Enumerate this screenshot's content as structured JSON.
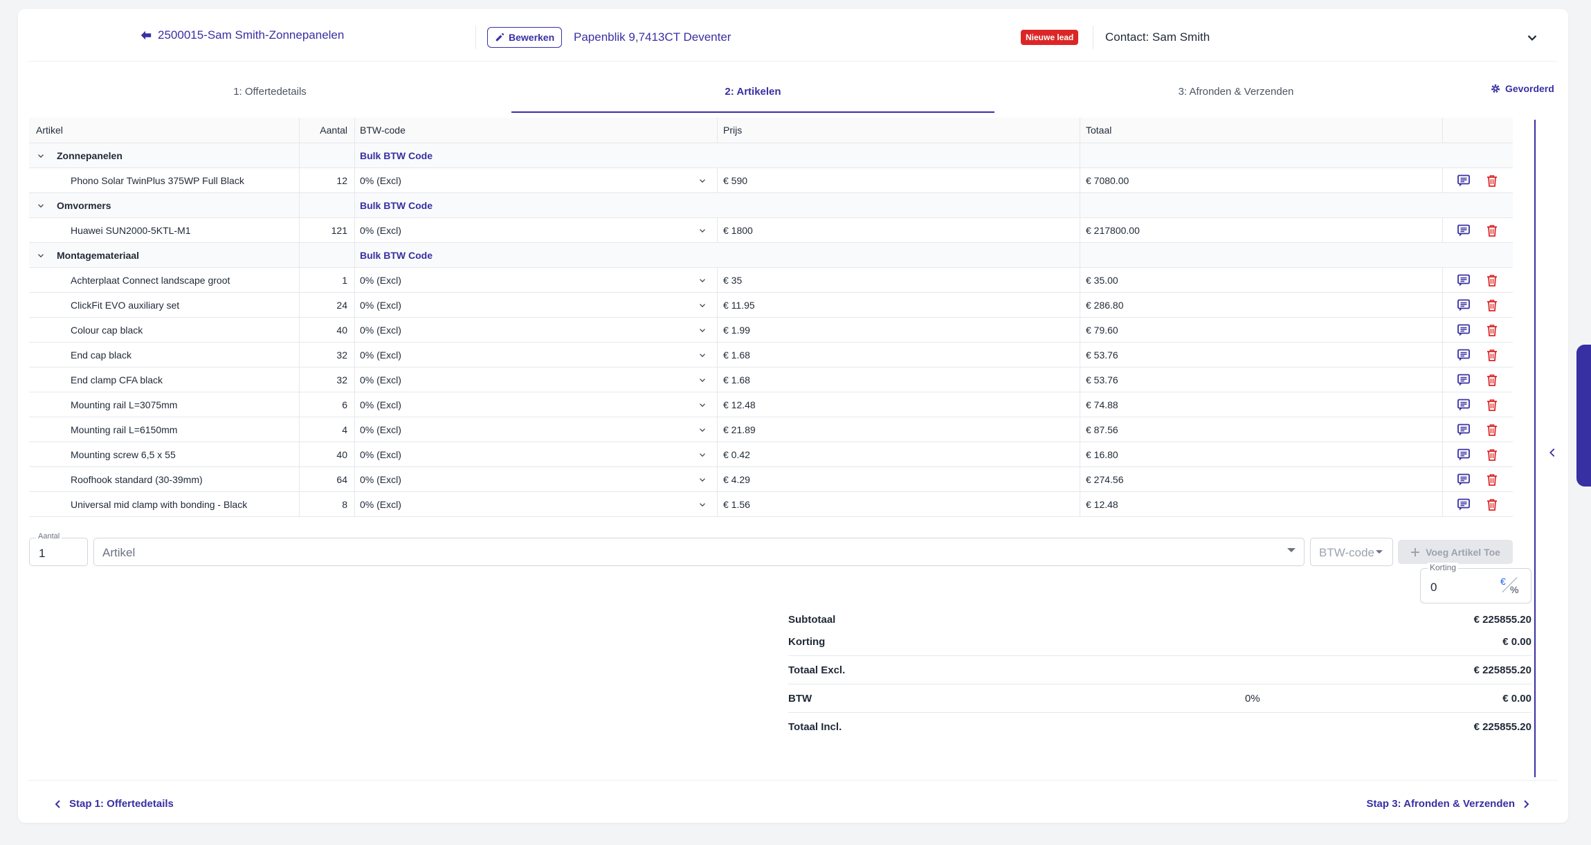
{
  "header": {
    "quote_title": "2500015-Sam Smith-Zonnepanelen",
    "edit_label": "Bewerken",
    "address": "Papenblik 9,7413CT Deventer",
    "lead_badge": "Nieuwe lead",
    "contact": "Contact: Sam Smith"
  },
  "tabs": [
    {
      "label": "1: Offertedetails",
      "active": false
    },
    {
      "label": "2: Artikelen",
      "active": true
    },
    {
      "label": "3: Afronden & Verzenden",
      "active": false
    }
  ],
  "advanced_label": "Gevorderd",
  "table": {
    "columns": {
      "article": "Artikel",
      "qty": "Aantal",
      "vat": "BTW-code",
      "price": "Prijs",
      "total": "Totaal"
    },
    "bulk_label": "Bulk BTW Code",
    "groups": [
      {
        "name": "Zonnepanelen",
        "items": [
          {
            "name": "Phono Solar TwinPlus 375WP Full Black",
            "qty": "12",
            "vat": "0% (Excl)",
            "price": "€ 590",
            "total": "€ 7080.00"
          }
        ]
      },
      {
        "name": "Omvormers",
        "items": [
          {
            "name": "Huawei SUN2000-5KTL-M1",
            "qty": "121",
            "vat": "0% (Excl)",
            "price": "€ 1800",
            "total": "€ 217800.00"
          }
        ]
      },
      {
        "name": "Montagemateriaal",
        "items": [
          {
            "name": "Achterplaat Connect landscape groot",
            "qty": "1",
            "vat": "0% (Excl)",
            "price": "€ 35",
            "total": "€ 35.00"
          },
          {
            "name": "ClickFit EVO auxiliary set",
            "qty": "24",
            "vat": "0% (Excl)",
            "price": "€ 11.95",
            "total": "€ 286.80"
          },
          {
            "name": "Colour cap black",
            "qty": "40",
            "vat": "0% (Excl)",
            "price": "€ 1.99",
            "total": "€ 79.60"
          },
          {
            "name": "End cap black",
            "qty": "32",
            "vat": "0% (Excl)",
            "price": "€ 1.68",
            "total": "€ 53.76"
          },
          {
            "name": "End clamp CFA black",
            "qty": "32",
            "vat": "0% (Excl)",
            "price": "€ 1.68",
            "total": "€ 53.76"
          },
          {
            "name": "Mounting rail L=3075mm",
            "qty": "6",
            "vat": "0% (Excl)",
            "price": "€ 12.48",
            "total": "€ 74.88"
          },
          {
            "name": "Mounting rail L=6150mm",
            "qty": "4",
            "vat": "0% (Excl)",
            "price": "€ 21.89",
            "total": "€ 87.56"
          },
          {
            "name": "Mounting screw 6,5 x 55",
            "qty": "40",
            "vat": "0% (Excl)",
            "price": "€ 0.42",
            "total": "€ 16.80"
          },
          {
            "name": "Roofhook standard (30-39mm)",
            "qty": "64",
            "vat": "0% (Excl)",
            "price": "€ 4.29",
            "total": "€ 274.56"
          },
          {
            "name": "Universal mid clamp with bonding - Black",
            "qty": "8",
            "vat": "0% (Excl)",
            "price": "€ 1.56",
            "total": "€ 12.48"
          }
        ]
      }
    ]
  },
  "add_item": {
    "qty_label": "Aantal",
    "qty_value": "1",
    "article_placeholder": "Artikel",
    "vat_placeholder": "BTW-code",
    "add_button": "Voeg Artikel Toe"
  },
  "discount": {
    "label": "Korting",
    "value": "0",
    "euro_symbol": "€",
    "percent_symbol": "%"
  },
  "summary": {
    "subtotal_label": "Subtotaal",
    "subtotal": "€ 225855.20",
    "discount_label": "Korting",
    "discount": "€ 0.00",
    "total_excl_label": "Totaal Excl.",
    "total_excl": "€ 225855.20",
    "vat_label": "BTW",
    "vat_rate": "0%",
    "vat": "€ 0.00",
    "total_incl_label": "Totaal Incl.",
    "total_incl": "€ 225855.20"
  },
  "footer": {
    "prev_label": "Stap 1: Offertedetails",
    "next_label": "Stap 3: Afronden & Verzenden"
  },
  "colors": {
    "accent": "#3730a3",
    "danger": "#dc2626"
  }
}
